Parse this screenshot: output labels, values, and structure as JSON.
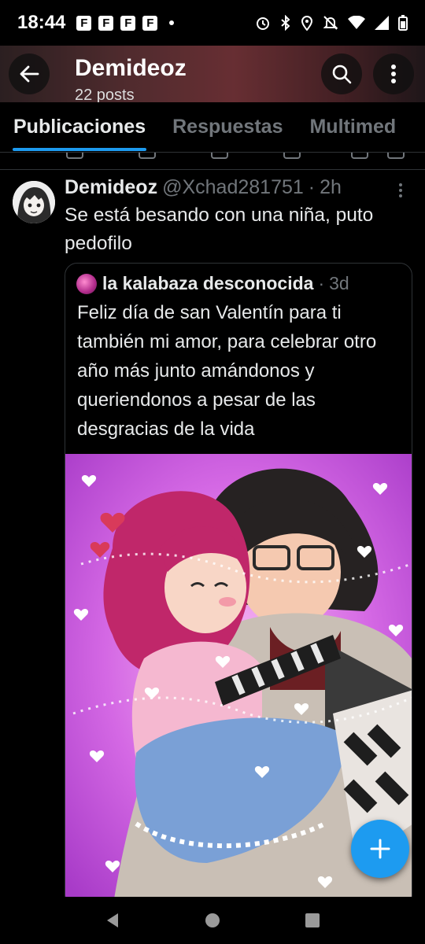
{
  "status_bar": {
    "time": "18:44",
    "notification_letters": [
      "F",
      "F",
      "F",
      "F"
    ],
    "icons": [
      "alarm-icon",
      "bluetooth-icon",
      "location-icon",
      "mute-icon",
      "wifi-icon",
      "signal-icon",
      "battery-icon"
    ]
  },
  "header": {
    "title": "Demideoz",
    "subtitle": "22 posts"
  },
  "tabs": [
    {
      "label": "Publicaciones",
      "active": true
    },
    {
      "label": "Respuestas",
      "active": false
    },
    {
      "label": "Multimed",
      "active": false
    }
  ],
  "tweet": {
    "author_name": "Demideoz",
    "handle": "@Xchad281751",
    "separator": "·",
    "time": "2h",
    "text": "Se está besando con una niña, puto pedofilo",
    "quote": {
      "author_name": "la kalabaza desconocida",
      "separator": "·",
      "time": "3d",
      "text": "Feliz día de san Valentín para ti también mi amor, para celebrar otro año más junto amándonos y queriendonos a pesar de las desgracias de la vida"
    }
  },
  "colors": {
    "accent": "#1d9bf0",
    "background": "#000000",
    "secondary_text": "#71767b",
    "image_background": "#c04fd8"
  }
}
